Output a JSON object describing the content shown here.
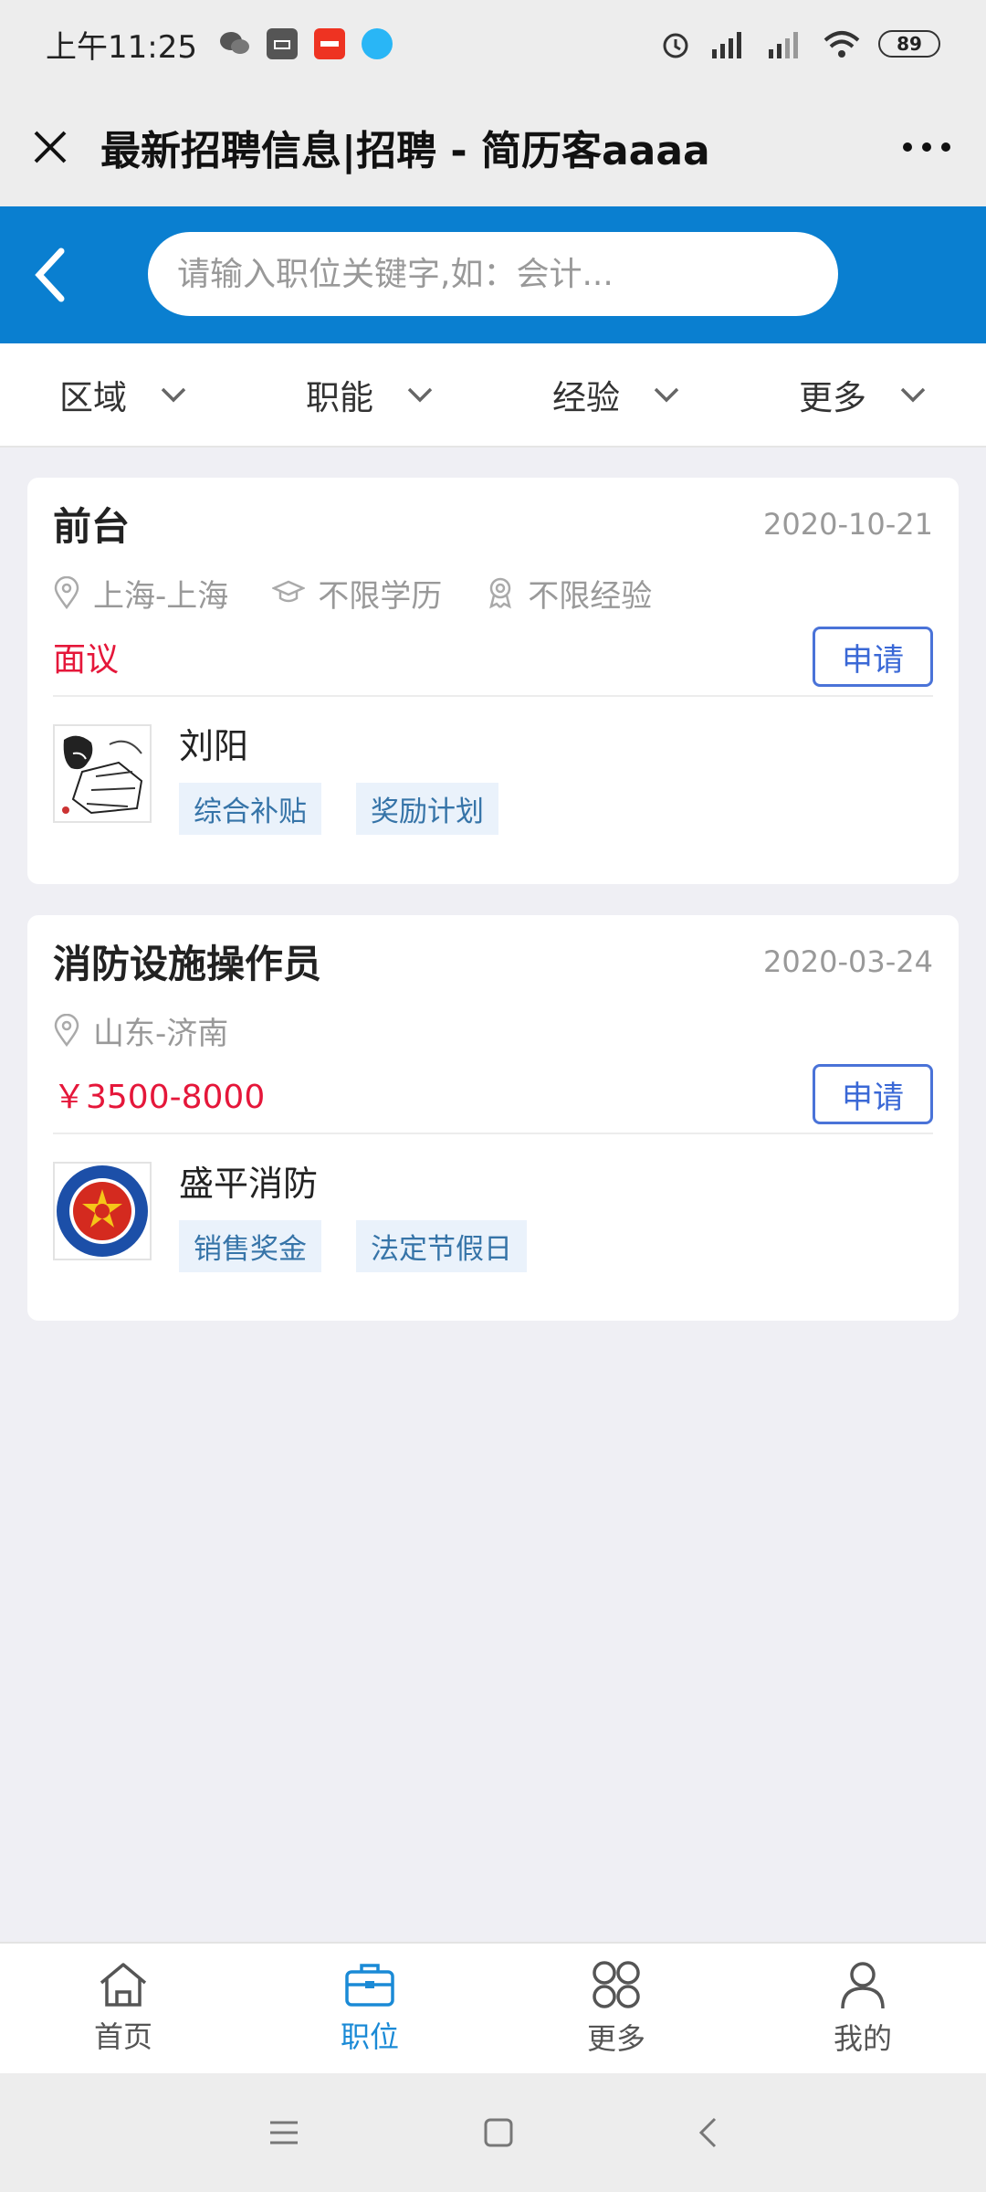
{
  "status_bar": {
    "time": "上午11:25",
    "battery": "89"
  },
  "title_bar": {
    "title": "最新招聘信息|招聘 - 简历客aaaa"
  },
  "search": {
    "placeholder": "请输入职位关键字,如：会计..."
  },
  "filters": [
    {
      "label": "区域"
    },
    {
      "label": "职能"
    },
    {
      "label": "经验"
    },
    {
      "label": "更多"
    }
  ],
  "jobs": [
    {
      "title": "前台",
      "date": "2020-10-21",
      "location": "上海-上海",
      "education": "不限学历",
      "experience": "不限经验",
      "salary": "面议",
      "apply_label": "申请",
      "company": "刘阳",
      "tags": [
        "综合补贴",
        "奖励计划"
      ]
    },
    {
      "title": "消防设施操作员",
      "date": "2020-03-24",
      "location": "山东-济南",
      "salary": "￥3500-8000",
      "apply_label": "申请",
      "company": "盛平消防",
      "tags": [
        "销售奖金",
        "法定节假日"
      ]
    }
  ],
  "bottom_nav": [
    {
      "label": "首页",
      "icon": "home-icon"
    },
    {
      "label": "职位",
      "icon": "briefcase-icon",
      "active": true
    },
    {
      "label": "更多",
      "icon": "grid-icon"
    },
    {
      "label": "我的",
      "icon": "user-icon"
    }
  ],
  "colors": {
    "header_blue": "#0a7fd0",
    "salary_red": "#e5173a",
    "apply_blue": "#3a68d6",
    "nav_active": "#1a8ad6"
  }
}
